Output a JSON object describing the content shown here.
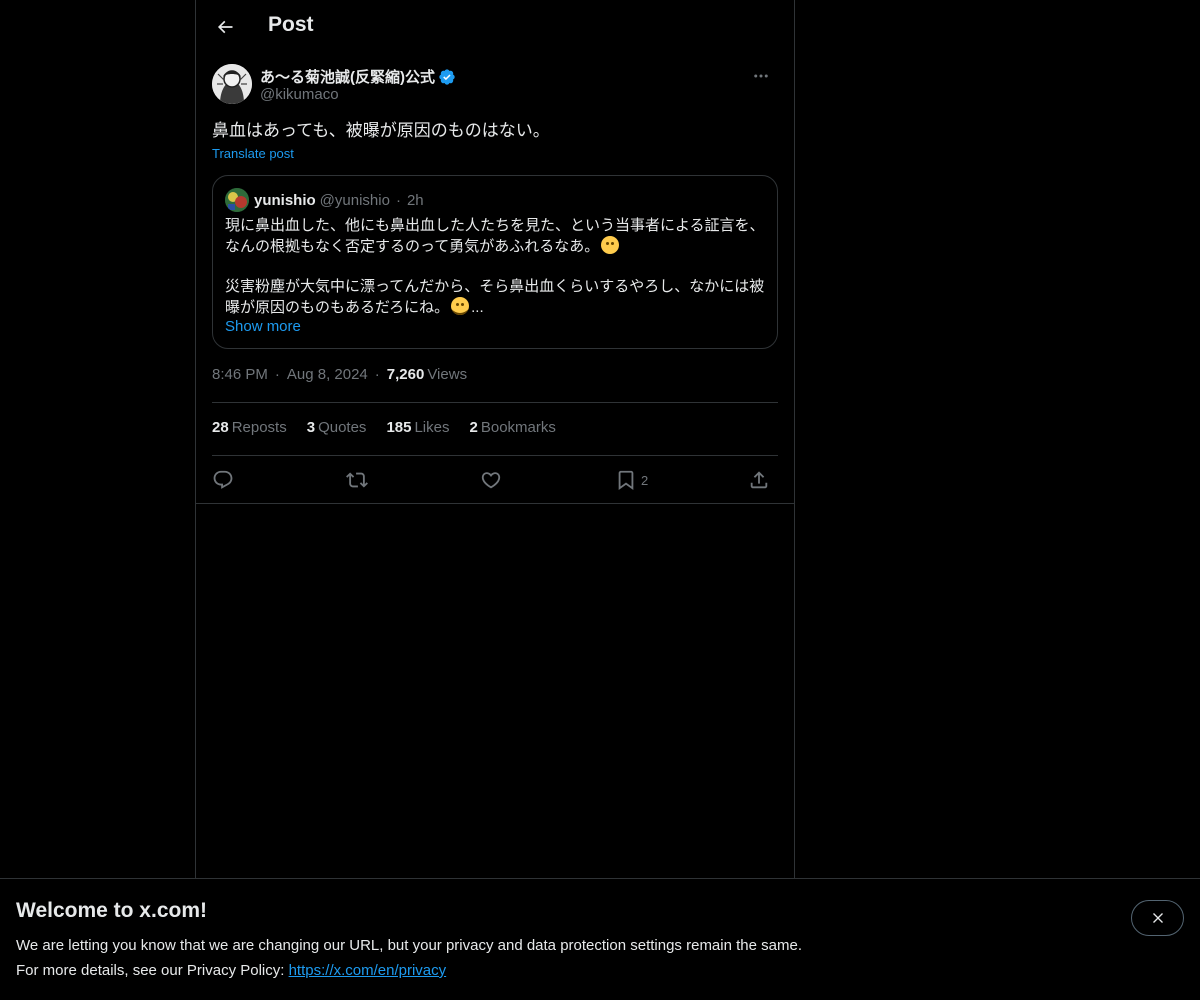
{
  "header": {
    "title": "Post"
  },
  "post": {
    "author_name": "あ〜る菊池誠(反緊縮)公式",
    "author_handle": "@kikumaco",
    "text": "鼻血はあっても、被曝が原因のものはない。",
    "translate_label": "Translate post",
    "time": "8:46 PM",
    "date": "Aug 8, 2024",
    "views_count": "7,260",
    "views_label": "Views"
  },
  "quote": {
    "author_name": "yunishio",
    "author_handle": "@yunishio",
    "time": "2h",
    "paragraph1": "現に鼻出血した、他にも鼻出血した人たちを見た、という当事者による証言を、なんの根拠もなく否定するのって勇気があふれるなあ。",
    "paragraph2": "災害粉塵が大気中に漂ってんだから、そら鼻出血くらいするやろし、なかには被曝が原因のものもあるだろにね。",
    "ellipsis": "...",
    "show_more": "Show more"
  },
  "stats": {
    "reposts_count": "28",
    "reposts_label": "Reposts",
    "quotes_count": "3",
    "quotes_label": "Quotes",
    "likes_count": "185",
    "likes_label": "Likes",
    "bookmarks_count": "2",
    "bookmarks_label": "Bookmarks"
  },
  "actions": {
    "bookmark_count": "2"
  },
  "banner": {
    "title": "Welcome to x.com!",
    "line1": "We are letting you know that we are changing our URL, but your privacy and data protection settings remain the same.",
    "line2_prefix": "For more details, see our Privacy Policy: ",
    "link": "https://x.com/en/privacy"
  },
  "colors": {
    "background": "#000000",
    "text": "#e7e9ea",
    "muted": "#71767b",
    "accent": "#1d9bf0",
    "border": "#2f3336"
  },
  "icons": {
    "back": "arrow-left-icon",
    "verified": "verified-badge-icon",
    "more": "more-horizontal-icon",
    "reply": "reply-icon",
    "repost": "repost-icon",
    "like": "heart-icon",
    "bookmark": "bookmark-icon",
    "share": "share-icon",
    "close": "close-icon",
    "emoji1": "rolling-eyes-emoji",
    "emoji2": "slightly-smiling-emoji"
  }
}
